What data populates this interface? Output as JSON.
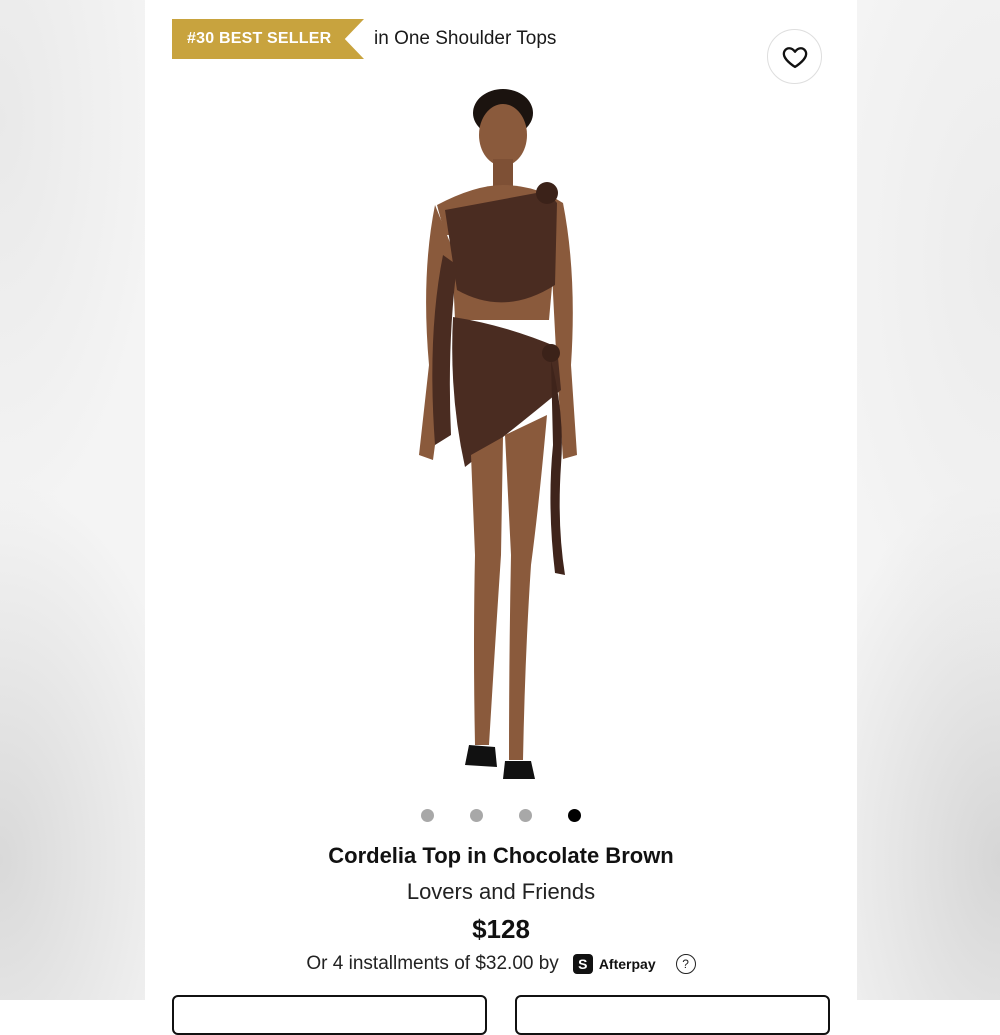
{
  "badge": {
    "label": "#30 BEST SELLER",
    "context": "in One Shoulder Tops"
  },
  "wishlist": {
    "icon": "heart-outline-icon"
  },
  "product_image": {
    "alt": "Model wearing chocolate brown one shoulder top and ruched mini skirt",
    "color": "#4a2c21"
  },
  "carousel": {
    "count": 4,
    "active_index": 3
  },
  "product": {
    "title": "Cordelia Top in Chocolate Brown",
    "brand": "Lovers and Friends",
    "price": "$128"
  },
  "installments": {
    "text": "Or 4 installments of $32.00 by",
    "provider": "Afterpay",
    "provider_icon": "afterpay-logo-icon",
    "help_icon": "question-circle-icon"
  },
  "colors": {
    "ribbon": "#c8a33e",
    "active_dot": "#000000",
    "inactive_dot": "#a8a8a8"
  }
}
